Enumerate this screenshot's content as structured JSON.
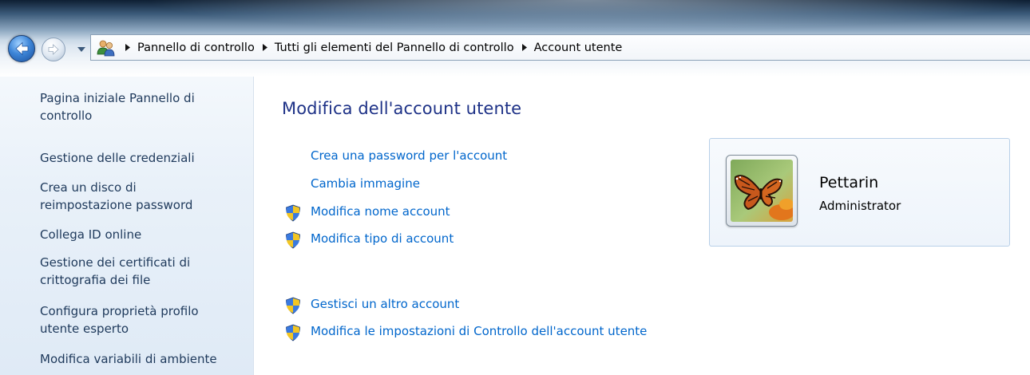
{
  "breadcrumb": {
    "items": [
      "Pannello di controllo",
      "Tutti gli elementi del Pannello di controllo",
      "Account utente"
    ]
  },
  "sidebar": {
    "items": [
      {
        "line1": "Pagina iniziale Pannello di",
        "line2": "controllo"
      },
      {
        "line1": "Gestione delle credenziali",
        "line2": ""
      },
      {
        "line1": "Crea un disco di",
        "line2": "reimpostazione password"
      },
      {
        "line1": "Collega ID online",
        "line2": ""
      },
      {
        "line1": "Gestione dei certificati di",
        "line2": "crittografia dei file"
      },
      {
        "line1": "Configura proprietà profilo",
        "line2": "utente esperto"
      },
      {
        "line1": "Modifica variabili di ambiente",
        "line2": ""
      }
    ]
  },
  "main": {
    "title": "Modifica dell'account utente",
    "tasks": [
      {
        "label": "Crea una password per l'account",
        "shield": false
      },
      {
        "label": "Cambia immagine",
        "shield": false
      },
      {
        "label": "Modifica nome account",
        "shield": true
      },
      {
        "label": "Modifica tipo di account",
        "shield": true
      },
      {
        "label": "Gestisci un altro account",
        "shield": true
      },
      {
        "label": "Modifica le impostazioni di Controllo dell'account utente",
        "shield": true
      }
    ]
  },
  "user": {
    "name": "Pettarin",
    "role": "Administrator"
  },
  "colors": {
    "link": "#0066cc",
    "title": "#1e3287",
    "sidebar_text": "#1e395b"
  },
  "icons": {
    "back": "back-arrow-icon",
    "forward": "forward-arrow-icon",
    "history": "chevron-down-icon",
    "location": "user-accounts-icon",
    "separator": "triangle-right-icon",
    "uac": "uac-shield-icon",
    "avatar": "butterfly-picture"
  }
}
